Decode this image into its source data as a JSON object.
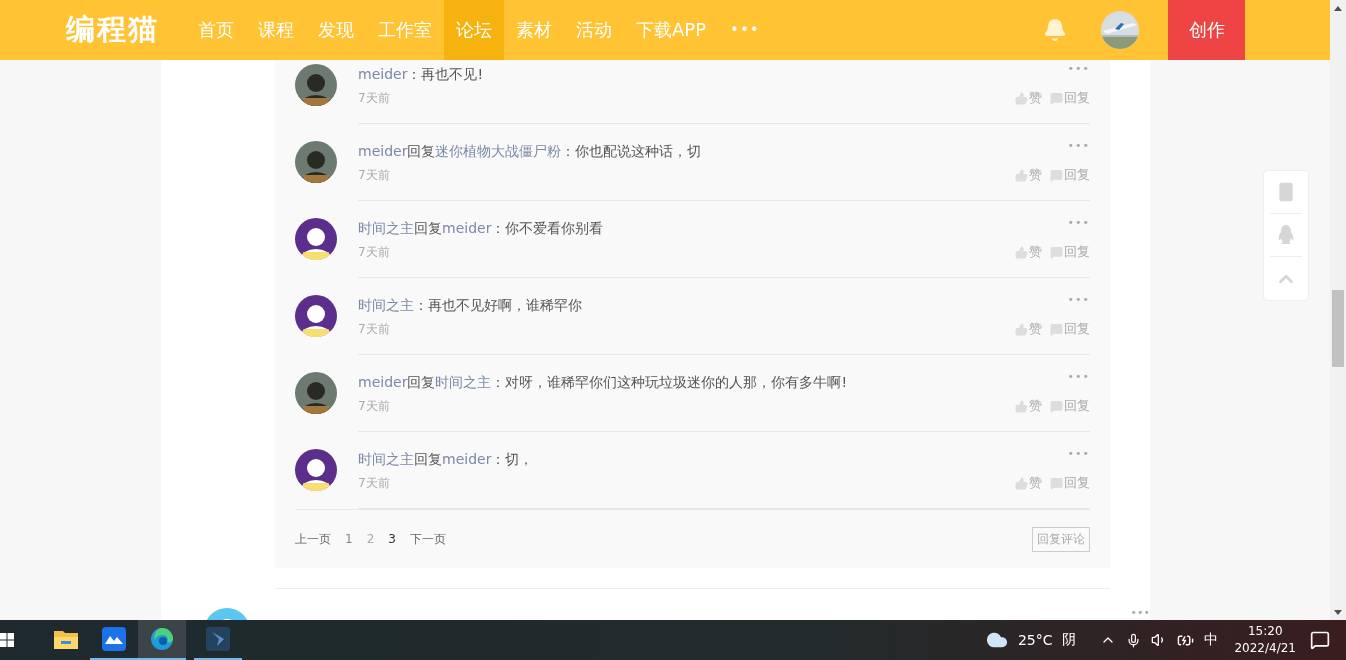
{
  "header": {
    "logo": "编程猫",
    "nav": [
      {
        "label": "首页",
        "selected": false
      },
      {
        "label": "课程",
        "selected": false
      },
      {
        "label": "发现",
        "selected": false
      },
      {
        "label": "工作室",
        "selected": false
      },
      {
        "label": "论坛",
        "selected": true
      },
      {
        "label": "素材",
        "selected": false
      },
      {
        "label": "活动",
        "selected": false
      },
      {
        "label": "下载APP",
        "selected": false
      }
    ],
    "more": "•••",
    "create_button": "创作"
  },
  "replies": [
    {
      "kind": "dark",
      "author": "meider",
      "text": "：再也不见!",
      "time": "7天前",
      "more": "•••",
      "like": "赞",
      "reply": "回复"
    },
    {
      "kind": "dark",
      "author": "meider",
      "reply_word": "回复",
      "reply_to": "迷你植物大战僵尸粉",
      "text": "：你也配说这种话，切",
      "time": "7天前",
      "more": "•••",
      "like": "赞",
      "reply": "回复"
    },
    {
      "kind": "purple",
      "author": "时间之主",
      "reply_word": "回复",
      "reply_to": "meider",
      "text": "：你不爱看你别看",
      "time": "7天前",
      "more": "•••",
      "like": "赞",
      "reply": "回复"
    },
    {
      "kind": "purple",
      "author": "时间之主",
      "text": "：再也不见好啊，谁稀罕你",
      "time": "7天前",
      "more": "•••",
      "like": "赞",
      "reply": "回复"
    },
    {
      "kind": "dark",
      "author": "meider",
      "reply_word": "回复",
      "reply_to": "时间之主",
      "text": "：对呀，谁稀罕你们这种玩垃圾迷你的人那，你有多牛啊!",
      "time": "7天前",
      "more": "•••",
      "like": "赞",
      "reply": "回复"
    },
    {
      "kind": "purple",
      "author": "时间之主",
      "reply_word": "回复",
      "reply_to": "meider",
      "text": "：切，",
      "time": "7天前",
      "more": "•••",
      "like": "赞",
      "reply": "回复"
    }
  ],
  "pagination": {
    "prev": "上一页",
    "pages": [
      {
        "label": "1",
        "selected": false
      },
      {
        "label": "2",
        "selected": false
      },
      {
        "label": "3",
        "selected": true
      }
    ],
    "next": "下一页",
    "reply_button": "回复评论"
  },
  "next_comment": {
    "kind": "blue",
    "more": "•••"
  },
  "taskbar": {
    "apps": [
      {
        "kind": "folder",
        "running": false,
        "selected": false
      },
      {
        "kind": "blue",
        "running": true,
        "selected": false
      },
      {
        "kind": "edge",
        "running": true,
        "selected": true
      },
      {
        "kind": "dark",
        "running": true,
        "selected": false
      }
    ],
    "temperature": "25°C",
    "weather": "阴",
    "ime": "中",
    "time": "15:20",
    "date": "2022/4/21"
  }
}
